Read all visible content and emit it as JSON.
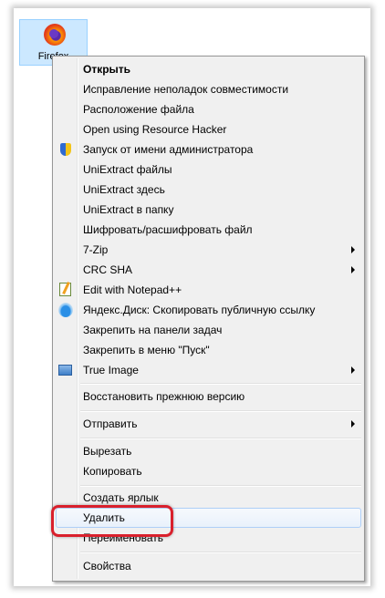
{
  "desktop_icon": {
    "label": "Firefox"
  },
  "menu": {
    "items": [
      {
        "label": "Открыть"
      },
      {
        "label": "Исправление неполадок совместимости"
      },
      {
        "label": "Расположение файла"
      },
      {
        "label": "Open using Resource Hacker"
      },
      {
        "label": "Запуск от имени администратора"
      },
      {
        "label": "UniExtract файлы"
      },
      {
        "label": "UniExtract здесь"
      },
      {
        "label": "UniExtract в папку"
      },
      {
        "label": "Шифровать/расшифровать файл"
      },
      {
        "label": "7-Zip"
      },
      {
        "label": "CRC SHA"
      },
      {
        "label": "Edit with Notepad++"
      },
      {
        "label": "Яндекс.Диск: Скопировать публичную ссылку"
      },
      {
        "label": "Закрепить на панели задач"
      },
      {
        "label": "Закрепить в меню \"Пуск\""
      },
      {
        "label": "True Image"
      },
      {
        "label": "Восстановить прежнюю версию"
      },
      {
        "label": "Отправить"
      },
      {
        "label": "Вырезать"
      },
      {
        "label": "Копировать"
      },
      {
        "label": "Создать ярлык"
      },
      {
        "label": "Удалить"
      },
      {
        "label": "Переименовать"
      },
      {
        "label": "Свойства"
      }
    ]
  },
  "colors": {
    "highlight_outline": "#d9202c",
    "hover_border": "#aecff7",
    "menu_bg": "#f0f0f0"
  },
  "icons": [
    "firefox-icon",
    "uac-shield-icon",
    "notepad-plus-plus-icon",
    "yandex-disk-icon",
    "true-image-icon",
    "submenu-arrow-icon"
  ]
}
